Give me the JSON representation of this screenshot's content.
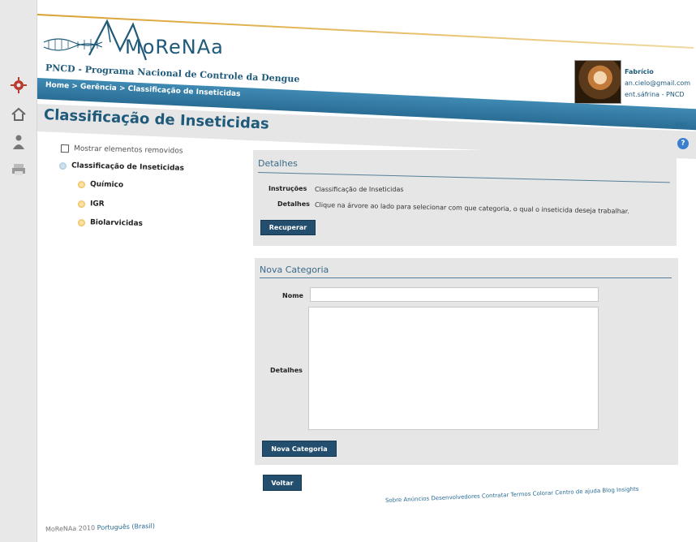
{
  "app": {
    "logo_text": "MoReNAa",
    "tagline": "PNCD - Programa Nacional de Controle da Dengue"
  },
  "user": {
    "name": "Fabrício",
    "email": "an.cielo@gmail.com",
    "role": "ent.sáfrina - PNCD"
  },
  "breadcrumb": "Home > Gerência > Classificação de Inseticidas",
  "page_title": "Classificação de Inseticidas",
  "header_link_sair": "Sair",
  "tree": {
    "show_removed_label": "Mostrar elementos removidos",
    "root_label": "Classificação de Inseticidas",
    "items": [
      {
        "label": "Químico"
      },
      {
        "label": "IGR"
      },
      {
        "label": "Biolarvicidas"
      }
    ]
  },
  "details_panel": {
    "title": "Detalhes",
    "instructions_label": "Instruções",
    "instructions_value": "Classificação de Inseticidas",
    "details_label": "Detalhes",
    "details_value": "Clique na árvore ao lado para selecionar com que categoria, o qual o inseticida deseja trabalhar.",
    "recover_button": "Recuperar"
  },
  "new_category_panel": {
    "title": "Nova Categoria",
    "name_label": "Nome",
    "name_value": "",
    "details_label": "Detalhes",
    "details_value": "",
    "submit_button": "Nova Categoria"
  },
  "back_button": "Voltar",
  "footer": {
    "links": "Sobre  Anúncios  Desenvolvedores  Contratar  Termos  Colorar  Centro de ajuda  Blog  Insights",
    "copyright": "MoReNAa 2010",
    "language": "Português (Brasil)"
  },
  "colors": {
    "brand_blue": "#2a6d95",
    "dark_button": "#234e6e",
    "panel_bg": "#e6e6e6",
    "accent_gold": "#d9a030"
  }
}
